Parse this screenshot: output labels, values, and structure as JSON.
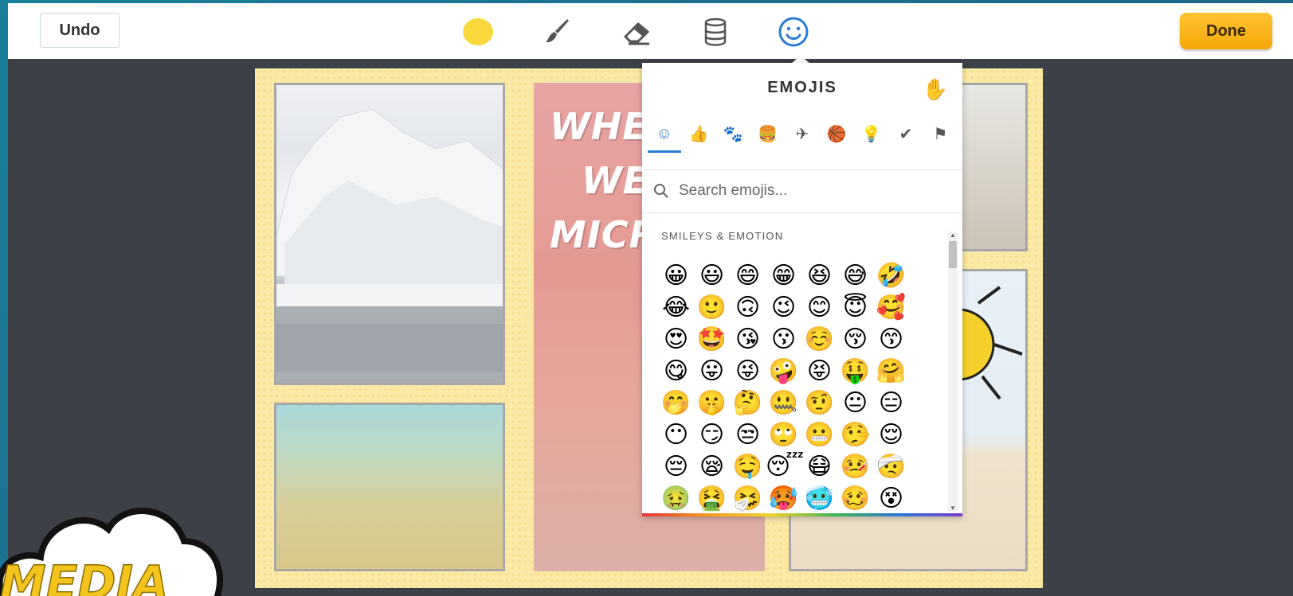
{
  "toolbar": {
    "undo_label": "Undo",
    "done_label": "Done",
    "active_color": "#f8d83a",
    "tools": [
      "color-picker-icon",
      "brush-icon",
      "eraser-icon",
      "paint-bucket-icon",
      "emoji-smiley-icon"
    ]
  },
  "board": {
    "poster_lines": [
      "WHER",
      "WE",
      "MICR"
    ],
    "logo_text": "MEDIA"
  },
  "emoji_picker": {
    "title": "EMOJIS",
    "skin_tone_icon": "✋",
    "categories": [
      {
        "icon": "☺",
        "name": "smileys"
      },
      {
        "icon": "👍",
        "name": "people"
      },
      {
        "icon": "🐾",
        "name": "animals"
      },
      {
        "icon": "🍔",
        "name": "food"
      },
      {
        "icon": "✈",
        "name": "travel"
      },
      {
        "icon": "🏀",
        "name": "activities"
      },
      {
        "icon": "💡",
        "name": "objects"
      },
      {
        "icon": "✔",
        "name": "symbols"
      },
      {
        "icon": "⚑",
        "name": "flags"
      }
    ],
    "search_placeholder": "Search emojis...",
    "section_label": "SMILEYS & EMOTION",
    "emojis": [
      "😀",
      "😃",
      "😄",
      "😁",
      "😆",
      "😅",
      "🤣",
      "😂",
      "🙂",
      "🙃",
      "😉",
      "😊",
      "😇",
      "🥰",
      "😍",
      "🤩",
      "😘",
      "😗",
      "☺️",
      "😚",
      "😙",
      "😋",
      "😛",
      "😜",
      "🤪",
      "😝",
      "🤑",
      "🤗",
      "🤭",
      "🤫",
      "🤔",
      "🤐",
      "🤨",
      "😐",
      "😑",
      "😶",
      "😏",
      "😒",
      "🙄",
      "😬",
      "🤥",
      "😌",
      "😔",
      "😪",
      "🤤",
      "😴",
      "😷",
      "🤒",
      "🤕",
      "🤢",
      "🤮",
      "🤧",
      "🥵",
      "🥶",
      "🥴",
      "😵"
    ]
  }
}
